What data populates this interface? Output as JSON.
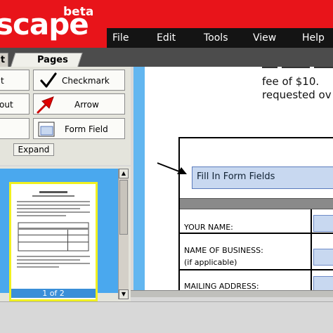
{
  "app": {
    "logo": "scape",
    "badge": "beta"
  },
  "menu": [
    "File",
    "Edit",
    "Tools",
    "View",
    "Help"
  ],
  "tabs": {
    "left": "t",
    "pages": "Pages"
  },
  "tools": {
    "left_labels": [
      "t",
      "out",
      ""
    ],
    "right_labels": [
      "Checkmark",
      "Arrow",
      "Form Field"
    ],
    "expand": "Expand"
  },
  "thumbnail": {
    "caption": "1 of 2"
  },
  "document": {
    "text_lines": [
      "fee of $10.",
      "requested ov"
    ],
    "fill_field": "Fill In Form Fields",
    "rows": [
      {
        "label": "YOUR NAME:"
      },
      {
        "label": "NAME OF BUSINESS:",
        "sub": "(if applicable)"
      },
      {
        "label": "MAILING ADDRESS:"
      }
    ]
  },
  "colors": {
    "brand": "#e8141a",
    "menubar": "#141414",
    "panel_blue": "#4aa8ee",
    "field": "#c8d8f0"
  }
}
